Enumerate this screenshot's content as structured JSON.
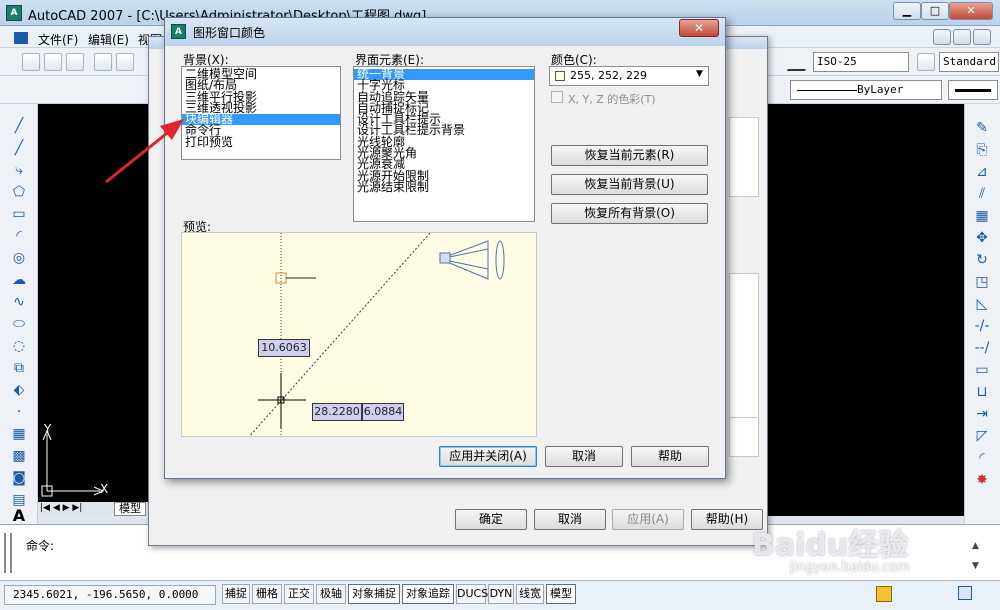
{
  "app": {
    "title": "AutoCAD 2007 - [C:\\Users\\Administrator\\Desktop\\工程图.dwg]",
    "icon_text": "A",
    "win_min": "▁",
    "win_max": "□",
    "win_close": "✕"
  },
  "menu": {
    "items": [
      "文件(F)",
      "编辑(E)",
      "视图"
    ]
  },
  "toolbar": {
    "dimstyle": "ISO-25",
    "textstyle": "Standard",
    "linetype": "ByLayer"
  },
  "canvas": {
    "axis_y": "Y",
    "axis_x": "X",
    "tab_model": "模型"
  },
  "command": {
    "prompt": "命令:"
  },
  "status": {
    "coords": "2345.6021, -196.5650, 0.0000",
    "toggles": [
      "捕捉",
      "栅格",
      "正交",
      "极轴",
      "对象捕捉",
      "对象追踪",
      "DUCS",
      "DYN",
      "线宽",
      "模型"
    ]
  },
  "options_dialog": {
    "ok": "确定",
    "cancel": "取消",
    "apply": "应用(A)",
    "help": "帮助(H)"
  },
  "dialog": {
    "title": "图形窗口颜色",
    "close": "✕",
    "background_label": "背景(X):",
    "backgrounds": [
      "二维模型空间",
      "图纸/布局",
      "三维平行投影",
      "三维透视投影",
      "块编辑器",
      "命令行",
      "打印预览"
    ],
    "selected_background": 4,
    "elements_label": "界面元素(E):",
    "elements": [
      "统一背景",
      "十字光标",
      "自动追踪矢量",
      "自动捕捉标记",
      "设计工具栏提示",
      "设计工具栏提示背景",
      "光线轮廓",
      "光源聚光角",
      "光源衰减",
      "光源开始限制",
      "光源结束限制"
    ],
    "selected_element": 0,
    "color_label": "颜色(C):",
    "color_value": "255, 252, 229",
    "color_hex": "#fffce5",
    "tint_label": "X, Y, Z 的色彩(T)",
    "restore_element": "恢复当前元素(R)",
    "restore_background": "恢复当前背景(U)",
    "restore_all": "恢复所有背景(O)",
    "preview_label": "预览:",
    "preview_tag1": "10.6063",
    "preview_tag2": "28.2280",
    "preview_tag3": "6.0884",
    "apply_close": "应用并关闭(A)",
    "cancel": "取消",
    "help": "帮助"
  },
  "watermark": {
    "text": "Baidu经验",
    "sub": "jingyan.baidu.com"
  },
  "colors": {
    "selection": "#3399ff",
    "arrow": "#e0242a",
    "canvas": "#000000"
  }
}
